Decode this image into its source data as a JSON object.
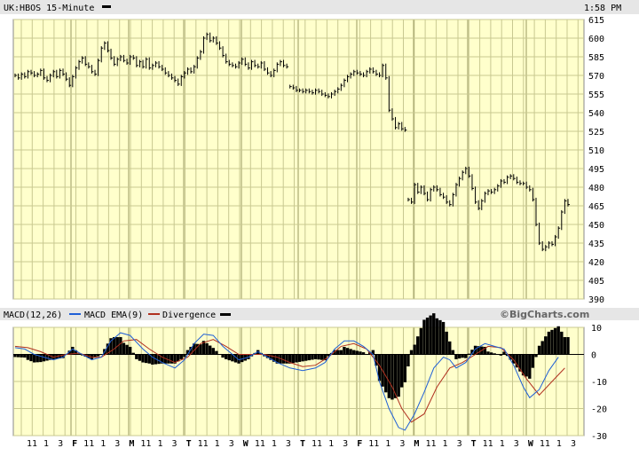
{
  "header": {
    "title": "UK:HBOS 15-Minute",
    "time": "1:58 PM"
  },
  "macd_header": {
    "macd_label": "MACD(12,26)",
    "ema_label": "MACD EMA(9)",
    "div_label": "Divergence",
    "watermark": "©BigCharts.com"
  },
  "colors": {
    "background": "#ffffcc",
    "grid": "#c8c890",
    "price": "#000000",
    "macd": "#1f5fd6",
    "ema": "#b03020",
    "divergence": "#000000"
  },
  "chart_data": [
    {
      "type": "line",
      "name": "price",
      "ylim": [
        390,
        615
      ],
      "yticks": [
        "615",
        "600",
        "585",
        "570",
        "555",
        "540",
        "525",
        "510",
        "495",
        "480",
        "465",
        "450",
        "435",
        "420",
        "405",
        "390"
      ],
      "sessions": [
        {
          "start": 0,
          "points": [
            570,
            568,
            571,
            569,
            573,
            572,
            570,
            571,
            574,
            568,
            566,
            570,
            573,
            569,
            574,
            571,
            567,
            562,
            569,
            576,
            581,
            584,
            579,
            577,
            573,
            571,
            582,
            592,
            596,
            590,
            584,
            579,
            583,
            585,
            582,
            580,
            585,
            584,
            578,
            581,
            577,
            583,
            576,
            578,
            580,
            577,
            575,
            572,
            570,
            568,
            566,
            563,
            569,
            572,
            575,
            573,
            577,
            584,
            589,
            600,
            603,
            598,
            600,
            596,
            592,
            586,
            581,
            579,
            578,
            577,
            580,
            583,
            579,
            576,
            581,
            578,
            577,
            580,
            575,
            572,
            570,
            574,
            579,
            581,
            578,
            577
          ]
        },
        {
          "start": 86,
          "points": [
            561,
            560,
            558,
            558,
            557,
            558,
            557,
            556,
            558,
            557,
            555,
            554,
            553,
            555,
            557,
            559,
            562,
            566,
            569,
            571,
            573,
            572,
            571,
            570,
            573,
            575,
            573,
            571,
            570,
            578,
            568,
            542,
            535,
            528,
            531,
            527,
            526
          ]
        },
        {
          "start": 123,
          "points": [
            470,
            468,
            482,
            476,
            480,
            475,
            470,
            478,
            480,
            478,
            474,
            472,
            468,
            466,
            474,
            482,
            487,
            492,
            495,
            489,
            479,
            468,
            463,
            469,
            475,
            477,
            476,
            478,
            481,
            485,
            484,
            488,
            489,
            487,
            484,
            483,
            483,
            480,
            478,
            470,
            450,
            435,
            430,
            432,
            435,
            434,
            440,
            447,
            460,
            469,
            466
          ]
        }
      ],
      "total_points": 174
    },
    {
      "type": "line",
      "name": "macd",
      "ylim": [
        -30,
        10
      ],
      "yticks": [
        "10",
        "0",
        "-10",
        "-20",
        "-30"
      ],
      "x_labels": [
        "11",
        "1",
        "3",
        "F",
        "11",
        "1",
        "3",
        "M",
        "11",
        "1",
        "3",
        "T",
        "11",
        "1",
        "3",
        "W",
        "11",
        "1",
        "3",
        "T",
        "11",
        "1",
        "3",
        "F",
        "11",
        "1",
        "3",
        "M",
        "11",
        "1",
        "3",
        "T",
        "11",
        "1",
        "3",
        "W",
        "11",
        "1",
        "3"
      ],
      "macd_points": [
        [
          0,
          2.5
        ],
        [
          3,
          2
        ],
        [
          6,
          0
        ],
        [
          9,
          -1
        ],
        [
          12,
          -2
        ],
        [
          15,
          -1
        ],
        [
          18,
          2
        ],
        [
          21,
          0
        ],
        [
          24,
          -2
        ],
        [
          27,
          -1
        ],
        [
          30,
          5
        ],
        [
          33,
          8
        ],
        [
          36,
          7
        ],
        [
          40,
          2
        ],
        [
          43,
          -1
        ],
        [
          46,
          -3
        ],
        [
          50,
          -5
        ],
        [
          53,
          -2
        ],
        [
          56,
          4
        ],
        [
          59,
          7.5
        ],
        [
          62,
          7
        ],
        [
          65,
          3
        ],
        [
          68,
          0
        ],
        [
          70,
          -2
        ],
        [
          73,
          -1
        ],
        [
          76,
          1
        ],
        [
          79,
          -1
        ],
        [
          82,
          -3
        ],
        [
          86,
          -5
        ],
        [
          90,
          -6
        ],
        [
          94,
          -5
        ],
        [
          97,
          -3
        ],
        [
          100,
          2
        ],
        [
          103,
          5
        ],
        [
          106,
          5
        ],
        [
          109,
          3
        ],
        [
          112,
          0
        ],
        [
          114,
          -10
        ],
        [
          117,
          -20
        ],
        [
          120,
          -27
        ],
        [
          122,
          -28
        ],
        [
          125,
          -22
        ],
        [
          128,
          -14
        ],
        [
          131,
          -5
        ],
        [
          134,
          -1
        ],
        [
          136,
          -2
        ],
        [
          138,
          -5
        ],
        [
          141,
          -3
        ],
        [
          144,
          2
        ],
        [
          147,
          4
        ],
        [
          150,
          3
        ],
        [
          153,
          2
        ],
        [
          156,
          -4
        ],
        [
          159,
          -12
        ],
        [
          161,
          -16
        ],
        [
          164,
          -13
        ],
        [
          167,
          -6
        ],
        [
          170,
          -1
        ]
      ],
      "ema_points": [
        [
          0,
          3
        ],
        [
          4,
          2.5
        ],
        [
          8,
          1
        ],
        [
          12,
          -1
        ],
        [
          16,
          0
        ],
        [
          20,
          0.5
        ],
        [
          24,
          -1
        ],
        [
          27,
          -1
        ],
        [
          31,
          2
        ],
        [
          34,
          5
        ],
        [
          38,
          5.5
        ],
        [
          42,
          2
        ],
        [
          46,
          -1
        ],
        [
          50,
          -3
        ],
        [
          54,
          -1
        ],
        [
          58,
          4
        ],
        [
          62,
          5.5
        ],
        [
          66,
          3
        ],
        [
          70,
          0
        ],
        [
          74,
          0
        ],
        [
          78,
          0
        ],
        [
          82,
          -1
        ],
        [
          86,
          -3
        ],
        [
          90,
          -4.5
        ],
        [
          94,
          -4
        ],
        [
          98,
          -1
        ],
        [
          102,
          3
        ],
        [
          106,
          4
        ],
        [
          110,
          2
        ],
        [
          114,
          -4
        ],
        [
          118,
          -12
        ],
        [
          121,
          -20
        ],
        [
          124,
          -25
        ],
        [
          128,
          -22
        ],
        [
          132,
          -12
        ],
        [
          136,
          -5
        ],
        [
          140,
          -3
        ],
        [
          144,
          0
        ],
        [
          148,
          3
        ],
        [
          152,
          2.5
        ],
        [
          156,
          -2
        ],
        [
          160,
          -9
        ],
        [
          164,
          -15
        ],
        [
          168,
          -10
        ],
        [
          172,
          -5
        ]
      ]
    }
  ]
}
